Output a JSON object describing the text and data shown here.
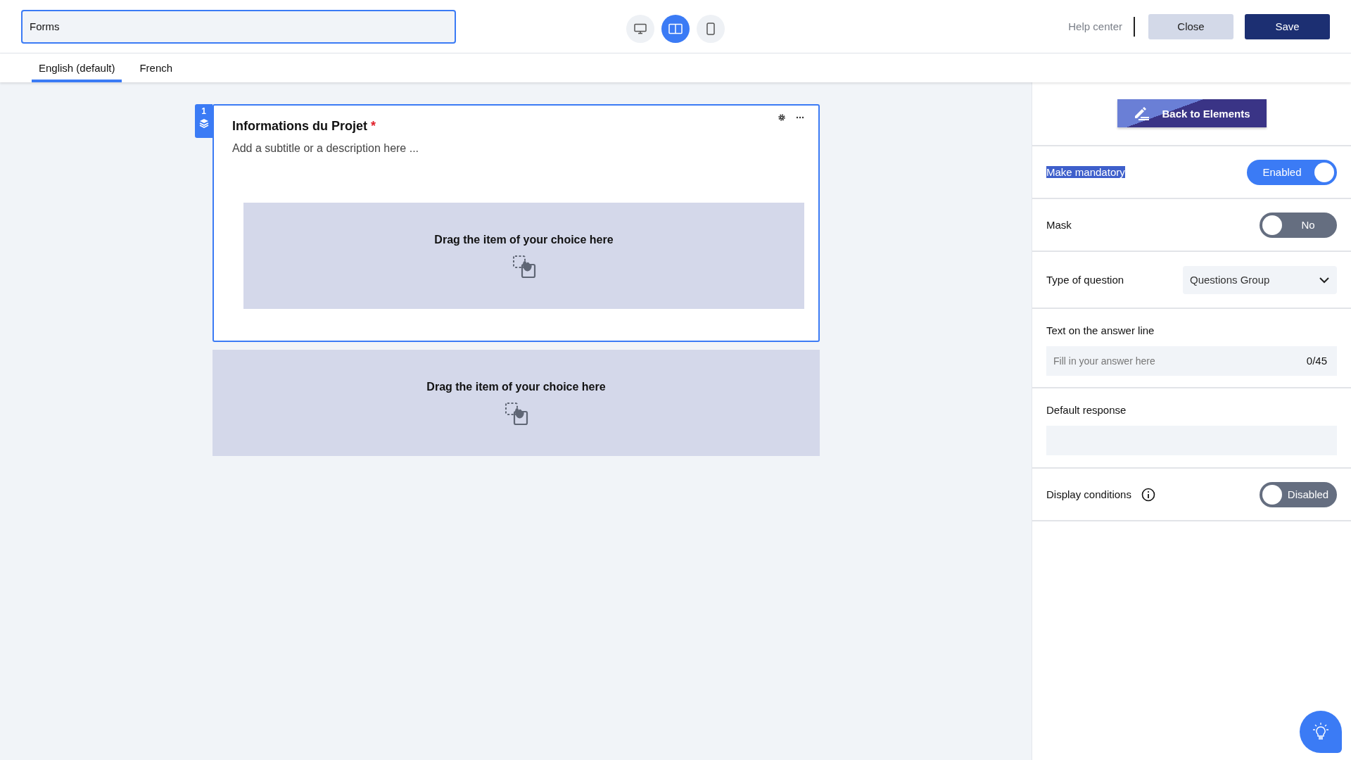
{
  "header": {
    "form_name": "Forms",
    "view_modes": [
      {
        "kind": "desktop",
        "selected": false
      },
      {
        "kind": "split",
        "selected": true
      },
      {
        "kind": "mobile",
        "selected": false
      }
    ],
    "help": "Help center",
    "close": "Close",
    "save": "Save"
  },
  "language_tabs": [
    {
      "label": "English (default)",
      "selected": true
    },
    {
      "label": "French",
      "selected": false
    }
  ],
  "canvas": {
    "section": {
      "number": "1",
      "title": "Informations du Projet",
      "required_mark": "*",
      "subtitle": "Add a subtitle or a description here ...",
      "dropzone": "Drag the item of your choice here"
    },
    "dropzone": "Drag the item of your choice here"
  },
  "panel": {
    "back": "Back to Elements",
    "settings": [
      {
        "kind": "toggle",
        "label": "Make mandatory",
        "highlighted": true,
        "on": true,
        "state": "Enabled"
      },
      {
        "kind": "toggle",
        "label": "Mask",
        "highlighted": false,
        "on": false,
        "state": "No"
      },
      {
        "kind": "select",
        "label": "Type of question",
        "value": "Questions Group"
      },
      {
        "kind": "text",
        "label": "Text on the answer line",
        "placeholder": "Fill in your answer here",
        "counter": "0/45"
      },
      {
        "kind": "text",
        "label": "Default response"
      },
      {
        "kind": "toggle",
        "label": "Display conditions",
        "info": true,
        "highlighted": false,
        "on": false,
        "state": "Disabled"
      }
    ]
  }
}
